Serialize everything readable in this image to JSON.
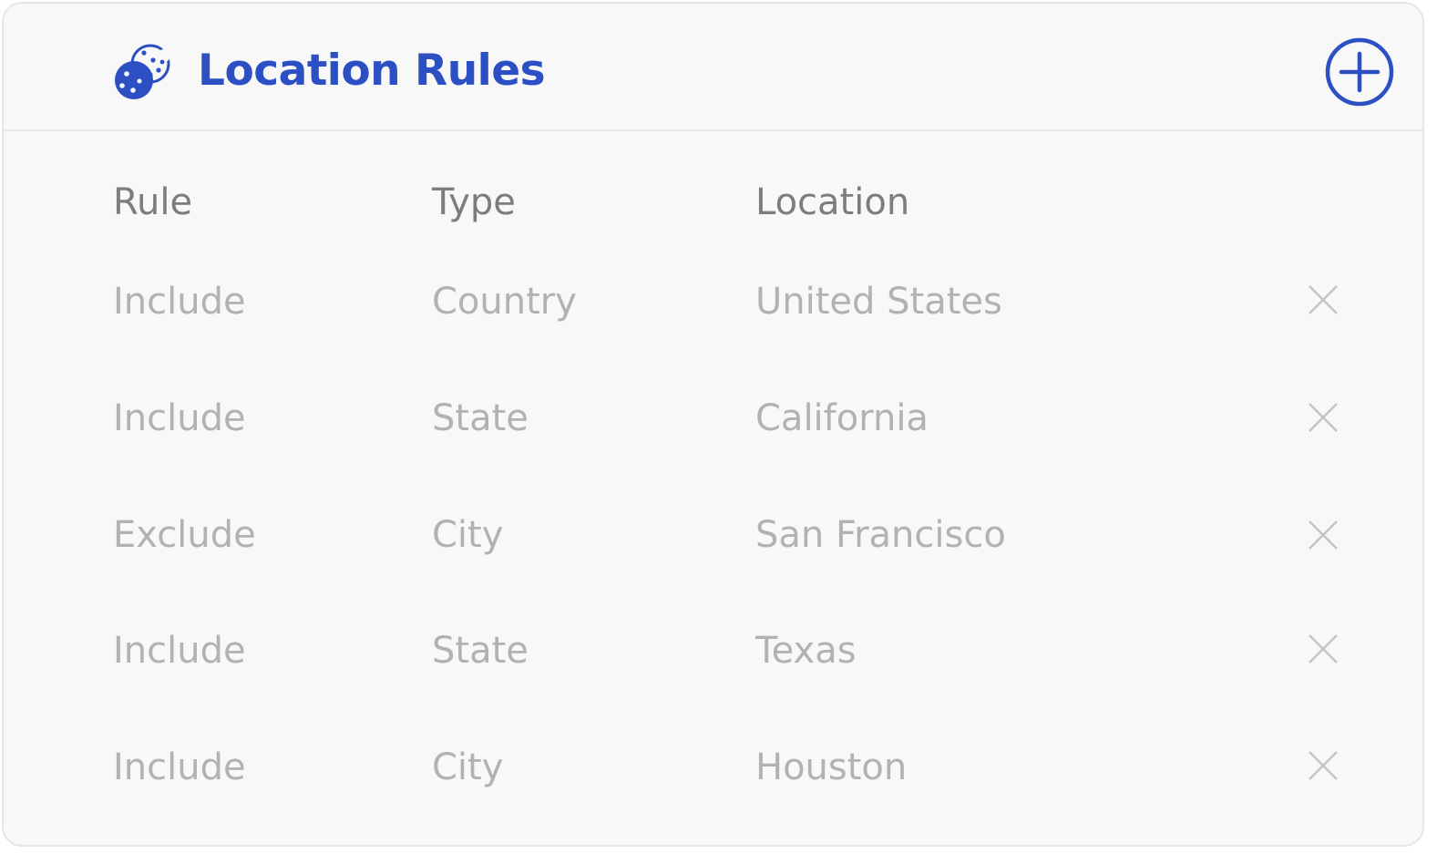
{
  "header": {
    "title": "Location Rules",
    "icon": "cookie-icon",
    "add_icon": "plus-circle-icon",
    "accent_color": "#2c4fc4"
  },
  "table": {
    "columns": [
      "Rule",
      "Type",
      "Location"
    ],
    "rows": [
      {
        "rule": "Include",
        "type": "Country",
        "location": "United States"
      },
      {
        "rule": "Include",
        "type": "State",
        "location": "California"
      },
      {
        "rule": "Exclude",
        "type": "City",
        "location": "San Francisco"
      },
      {
        "rule": "Include",
        "type": "State",
        "location": "Texas"
      },
      {
        "rule": "Include",
        "type": "City",
        "location": "Houston"
      }
    ],
    "delete_icon": "close-icon",
    "header_text_color": "#7d7d7d",
    "cell_text_color": "#b2b2b2"
  }
}
